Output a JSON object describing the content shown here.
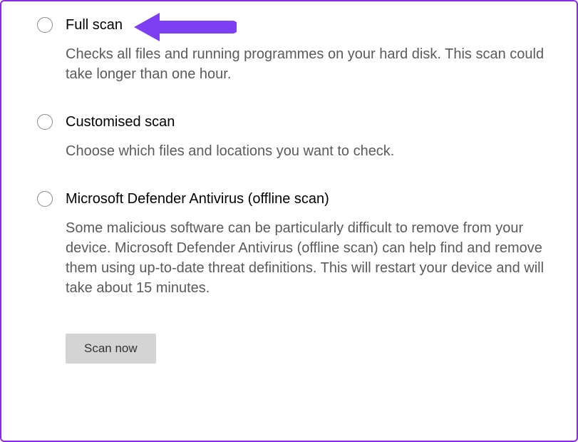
{
  "options": [
    {
      "title": "Full scan",
      "desc": "Checks all files and running programmes on your hard disk. This scan could take longer than one hour."
    },
    {
      "title": "Customised scan",
      "desc": "Choose which files and locations you want to check."
    },
    {
      "title": "Microsoft Defender Antivirus (offline scan)",
      "desc": "Some malicious software can be particularly difficult to remove from your device. Microsoft Defender Antivirus (offline scan) can help find and remove them using up-to-date threat definitions. This will restart your device and will take about 15 minutes."
    }
  ],
  "button": {
    "scan": "Scan now"
  }
}
